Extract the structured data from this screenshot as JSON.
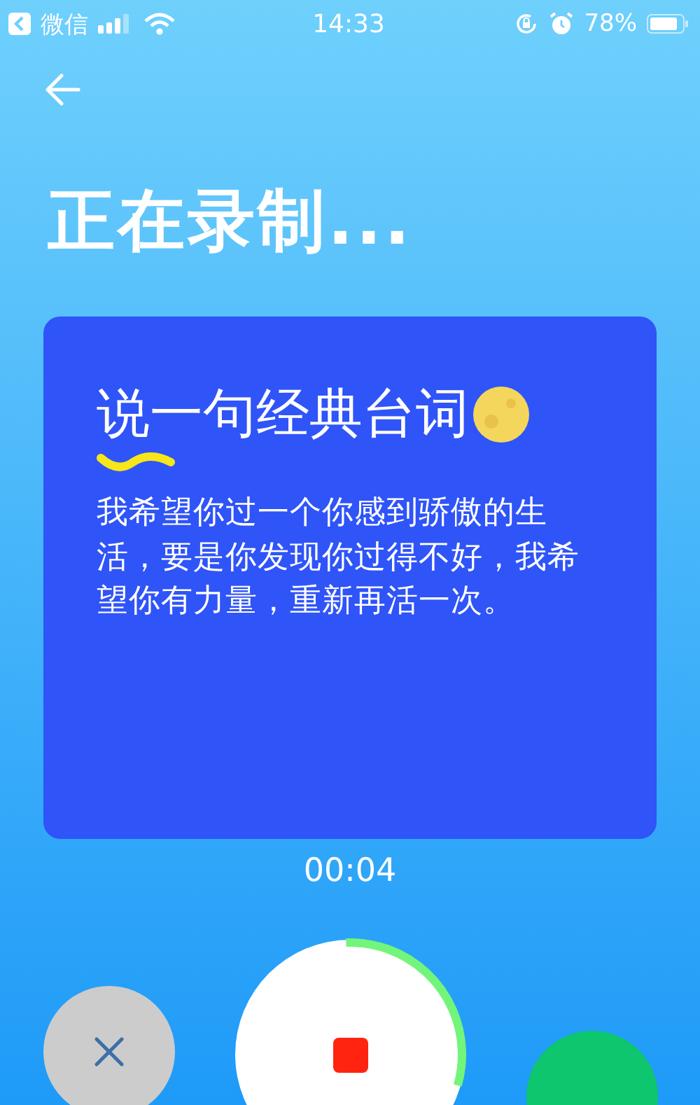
{
  "status_bar": {
    "back_app": "微信",
    "time": "14:33",
    "battery": "78%"
  },
  "title": "正在录制...",
  "card": {
    "heading": "说一句经典台词",
    "text": "我希望你过一个你感到骄傲的生活，要是你发现你过得不好，我希望你有力量，重新再活一次。"
  },
  "timer": "00:04",
  "recording": {
    "level": 0.3
  }
}
